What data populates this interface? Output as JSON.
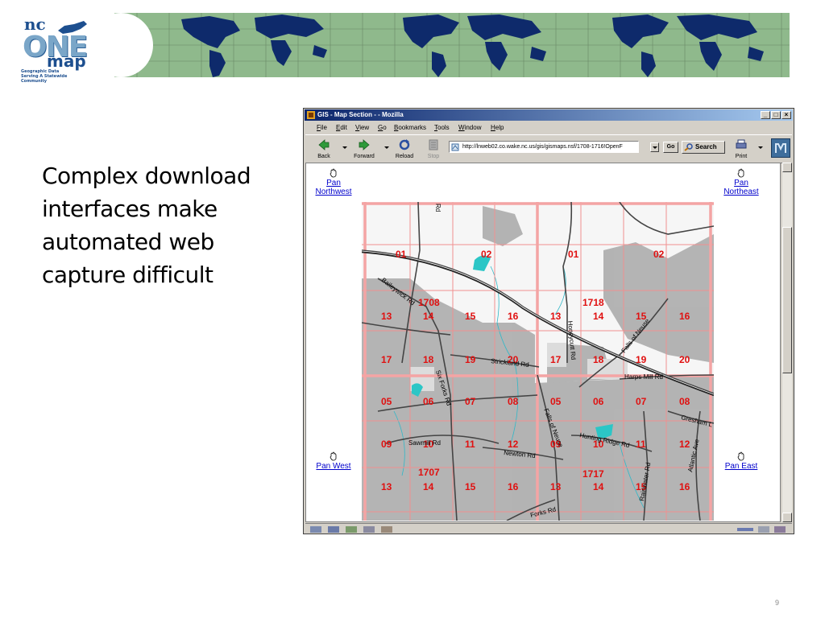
{
  "slide": {
    "bullet": "Complex download interfaces make automated web capture difficult",
    "page_number": "9"
  },
  "logo": {
    "nc": "nc",
    "one": "ONE",
    "map": "map",
    "tagline": "Geographic Data Serving A Statewide Community"
  },
  "window": {
    "title": "GIS - Map Section - - Mozilla",
    "menu": [
      "File",
      "Edit",
      "View",
      "Go",
      "Bookmarks",
      "Tools",
      "Window",
      "Help"
    ],
    "toolbar": {
      "back": "Back",
      "forward": "Forward",
      "reload": "Reload",
      "stop": "Stop",
      "url": "http://lnweb02.co.wake.nc.us/gis/gismaps.nsf/1708-1716!OpenF",
      "go": "Go",
      "search": "Search",
      "print": "Print"
    }
  },
  "page": {
    "pan_nw_1": "Pan",
    "pan_nw_2": "Northwest",
    "pan_ne_1": "Pan",
    "pan_ne_2": "Northeast",
    "pan_w": "Pan West",
    "pan_e": "Pan East"
  },
  "map": {
    "grid_labels": [
      [
        "01",
        "02",
        "01",
        "02"
      ],
      [
        "13",
        "14",
        "15",
        "16",
        "13",
        "14",
        "15",
        "16"
      ],
      [
        "17",
        "18",
        "19",
        "20",
        "17",
        "18",
        "19",
        "20"
      ],
      [
        "05",
        "06",
        "07",
        "08",
        "05",
        "06",
        "07",
        "08"
      ],
      [
        "09",
        "10",
        "11",
        "12",
        "09",
        "10",
        "11",
        "12"
      ],
      [
        "13",
        "14",
        "15",
        "16",
        "13",
        "14",
        "15",
        "16"
      ]
    ],
    "section_labels": [
      "1708",
      "1718",
      "1707",
      "1717"
    ],
    "roads": [
      "Rd",
      "Baileywick Rd",
      "Honeycutt Rd",
      "Falls of Neuse",
      "Strickland Rd",
      "Harps Mill Rd",
      "Six Forks Rd",
      "Gresham L",
      "Sawmill Rd",
      "Newton Rd",
      "Falls of Neuse",
      "Hunting Ridge Rd",
      "Rainwater Rd",
      "Atlantic Ave",
      "Forks Rd"
    ]
  }
}
